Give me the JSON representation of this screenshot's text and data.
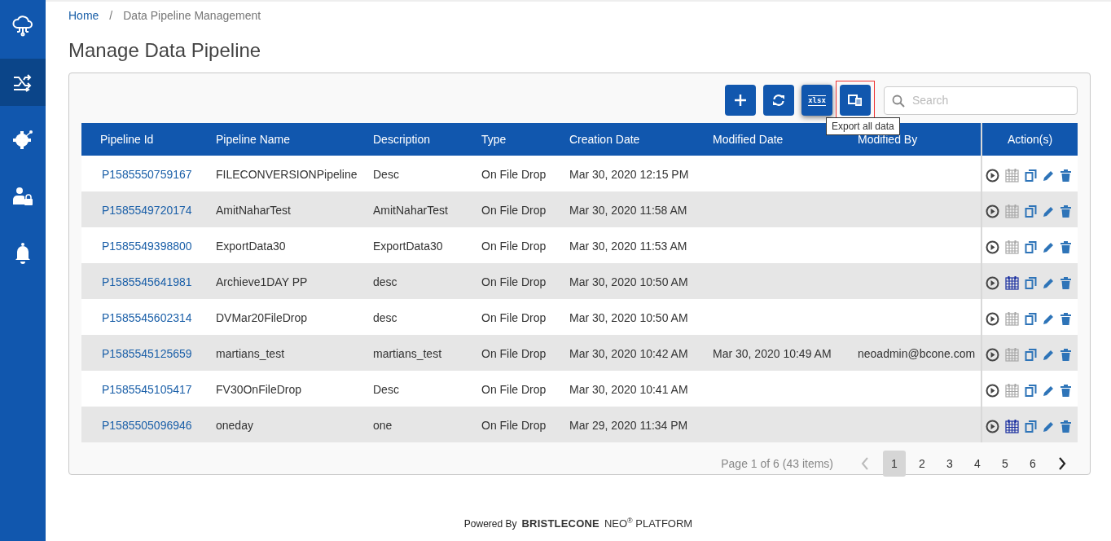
{
  "sidebar": {
    "items": [
      {
        "selected": false
      },
      {
        "selected": true
      },
      {
        "selected": false
      },
      {
        "selected": false
      },
      {
        "selected": false
      }
    ]
  },
  "breadcrumb": {
    "home": "Home",
    "separator": "/",
    "current": "Data Pipeline Management"
  },
  "title": "Manage Data Pipeline",
  "toolbar": {
    "buttons": [
      {
        "kind": "add",
        "focused": false
      },
      {
        "kind": "refresh",
        "focused": false
      },
      {
        "kind": "xlsx",
        "label": "xlsx",
        "focused": false
      },
      {
        "kind": "export",
        "focused": true
      }
    ],
    "tooltip": "Export all data",
    "search": {
      "placeholder": "Search"
    }
  },
  "table": {
    "columns": [
      "Pipeline Id",
      "Pipeline Name",
      "Description",
      "Type",
      "Creation Date",
      "Modified Date",
      "Modified By",
      "Action(s)"
    ],
    "rows": [
      {
        "id": "P1585550759167",
        "name": "FILECONVERSIONPipeline",
        "description": "Desc",
        "type": "On File Drop",
        "created": "Mar 30, 2020 12:15 PM",
        "modified": "",
        "modified_by": "",
        "scheduled": false
      },
      {
        "id": "P1585549720174",
        "name": "AmitNaharTest",
        "description": "AmitNaharTest",
        "type": "On File Drop",
        "created": "Mar 30, 2020 11:58 AM",
        "modified": "",
        "modified_by": "",
        "scheduled": false
      },
      {
        "id": "P1585549398800",
        "name": "ExportData30",
        "description": "ExportData30",
        "type": "On File Drop",
        "created": "Mar 30, 2020 11:53 AM",
        "modified": "",
        "modified_by": "",
        "scheduled": false
      },
      {
        "id": "P1585545641981",
        "name": "Archieve1DAY PP",
        "description": "desc",
        "type": "On File Drop",
        "created": "Mar 30, 2020 10:50 AM",
        "modified": "",
        "modified_by": "",
        "scheduled": true
      },
      {
        "id": "P1585545602314",
        "name": "DVMar20FileDrop",
        "description": "desc",
        "type": "On File Drop",
        "created": "Mar 30, 2020 10:50 AM",
        "modified": "",
        "modified_by": "",
        "scheduled": false
      },
      {
        "id": "P1585545125659",
        "name": "martians_test",
        "description": "martians_test",
        "type": "On File Drop",
        "created": "Mar 30, 2020 10:42 AM",
        "modified": "Mar 30, 2020 10:49 AM",
        "modified_by": "neoadmin@bcone.com",
        "scheduled": false
      },
      {
        "id": "P1585545105417",
        "name": "FV30OnFileDrop",
        "description": "Desc",
        "type": "On File Drop",
        "created": "Mar 30, 2020 10:41 AM",
        "modified": "",
        "modified_by": "",
        "scheduled": false
      },
      {
        "id": "P1585505096946",
        "name": "oneday",
        "description": "one",
        "type": "On File Drop",
        "created": "Mar 29, 2020 11:34 PM",
        "modified": "",
        "modified_by": "",
        "scheduled": true
      }
    ]
  },
  "pagination": {
    "summary": "Page 1 of 6 (43 items)",
    "pages": [
      {
        "label": "1",
        "selected": true
      },
      {
        "label": "2",
        "selected": false
      },
      {
        "label": "3",
        "selected": false
      },
      {
        "label": "4",
        "selected": false
      },
      {
        "label": "5",
        "selected": false
      },
      {
        "label": "6",
        "selected": false
      }
    ]
  },
  "footer": {
    "powered": "Powered By",
    "brand": "BRISTLECONE",
    "product": "NEO$^{®}$ PLATFORM"
  }
}
